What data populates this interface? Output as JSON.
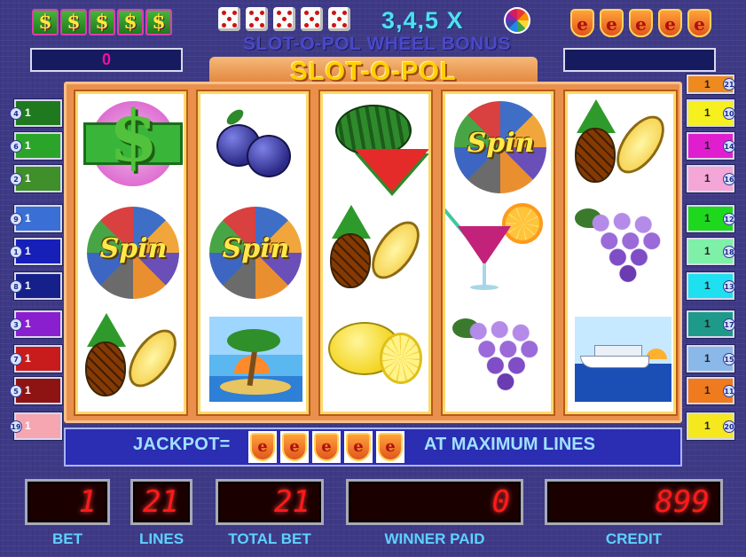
{
  "header": {
    "multiplier_text": "3,4,5 X",
    "bonus_title": "SLOT-O-POL WHEEL BONUS",
    "logo": "SLOT-O-POL",
    "dollar_icons": [
      "$",
      "$",
      "$",
      "$",
      "$"
    ],
    "shield_icons": [
      "e",
      "e",
      "e",
      "e",
      "e"
    ],
    "left_counter": "0",
    "right_counter": ""
  },
  "reels": [
    [
      "dollar",
      "spin",
      "pineapple"
    ],
    [
      "plum",
      "spin",
      "island"
    ],
    [
      "watermelon",
      "pineapple",
      "lemon"
    ],
    [
      "spin",
      "cocktail",
      "grapes"
    ],
    [
      "pineapple",
      "grapes",
      "ship"
    ]
  ],
  "symbols": {
    "spin_label": "Spin",
    "dollar_char": "$"
  },
  "lines_left": [
    {
      "num": "4",
      "value": "1",
      "color": "#1f7a1f"
    },
    {
      "num": "6",
      "value": "1",
      "color": "#2aa52a"
    },
    {
      "num": "2",
      "value": "1",
      "color": "#3f8f2a"
    },
    {
      "num": "9",
      "value": "1",
      "color": "#3a6fd6"
    },
    {
      "num": "1",
      "value": "1",
      "color": "#1620b8"
    },
    {
      "num": "8",
      "value": "1",
      "color": "#15208a"
    },
    {
      "num": "3",
      "value": "1",
      "color": "#8a1fd0"
    },
    {
      "num": "7",
      "value": "1",
      "color": "#c81c1c"
    },
    {
      "num": "5",
      "value": "1",
      "color": "#8e1414"
    },
    {
      "num": "19",
      "value": "1",
      "color": "#f5a6b0"
    }
  ],
  "lines_right": [
    {
      "num": "21",
      "value": "1",
      "color": "#f08a1e"
    },
    {
      "num": "10",
      "value": "1",
      "color": "#f5f01e"
    },
    {
      "num": "14",
      "value": "1",
      "color": "#e01ed0"
    },
    {
      "num": "16",
      "value": "1",
      "color": "#f5a6d8"
    },
    {
      "num": "12",
      "value": "1",
      "color": "#1ed81e"
    },
    {
      "num": "18",
      "value": "1",
      "color": "#7ef0a8"
    },
    {
      "num": "13",
      "value": "1",
      "color": "#1ee0f0"
    },
    {
      "num": "17",
      "value": "1",
      "color": "#1e9a8a"
    },
    {
      "num": "15",
      "value": "1",
      "color": "#8ab8e8"
    },
    {
      "num": "11",
      "value": "1",
      "color": "#f07a1e"
    },
    {
      "num": "20",
      "value": "1",
      "color": "#f5e81e"
    }
  ],
  "jackpot": {
    "label": "JACKPOT=",
    "shields": [
      "e",
      "e",
      "e",
      "e",
      "e"
    ],
    "suffix": "AT MAXIMUM LINES"
  },
  "displays": {
    "bet": {
      "label": "BET",
      "value": "1"
    },
    "lines": {
      "label": "LINES",
      "value": "21"
    },
    "total_bet": {
      "label": "TOTAL BET",
      "value": "21"
    },
    "winner_paid": {
      "label": "WINNER PAID",
      "value": "0"
    },
    "credit": {
      "label": "CREDIT",
      "value": "899"
    }
  }
}
